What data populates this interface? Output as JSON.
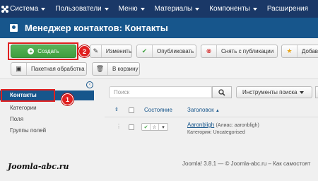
{
  "navbar": {
    "items": [
      "Система",
      "Пользователи",
      "Меню",
      "Материалы",
      "Компоненты",
      "Расширения"
    ]
  },
  "header": {
    "title": "Менеджер контактов: Контакты"
  },
  "toolbar": {
    "create": "Создать",
    "edit": "Изменить",
    "publish": "Опубликовать",
    "unpublish": "Снять с публикации",
    "featured": "Добави",
    "batch": "Пакетная обработка",
    "trash": "В корзину",
    "badge_create": "2",
    "badge_sidebar": "1"
  },
  "sidebar": {
    "items": [
      "Контакты",
      "Категории",
      "Поля",
      "Группы полей"
    ]
  },
  "filters": {
    "search_placeholder": "Поиск",
    "search_tools": "Инструменты поиска"
  },
  "table": {
    "headers": {
      "status": "Состояние",
      "title": "Заголовок"
    },
    "rows": [
      {
        "title": "Aaronbligh",
        "alias": "(Алиас: aaronbligh)",
        "category": "Категория: Uncategorised"
      }
    ]
  },
  "footer": {
    "brand": "Joomla-abc.ru",
    "copyright": "Joomla! 3.8.1 — © Joomla-abc.ru – Как самостоят"
  },
  "colors": {
    "navbar": "#1a3867",
    "header": "#17568c",
    "create_button": "#46a546",
    "highlight_box": "#e02020"
  }
}
